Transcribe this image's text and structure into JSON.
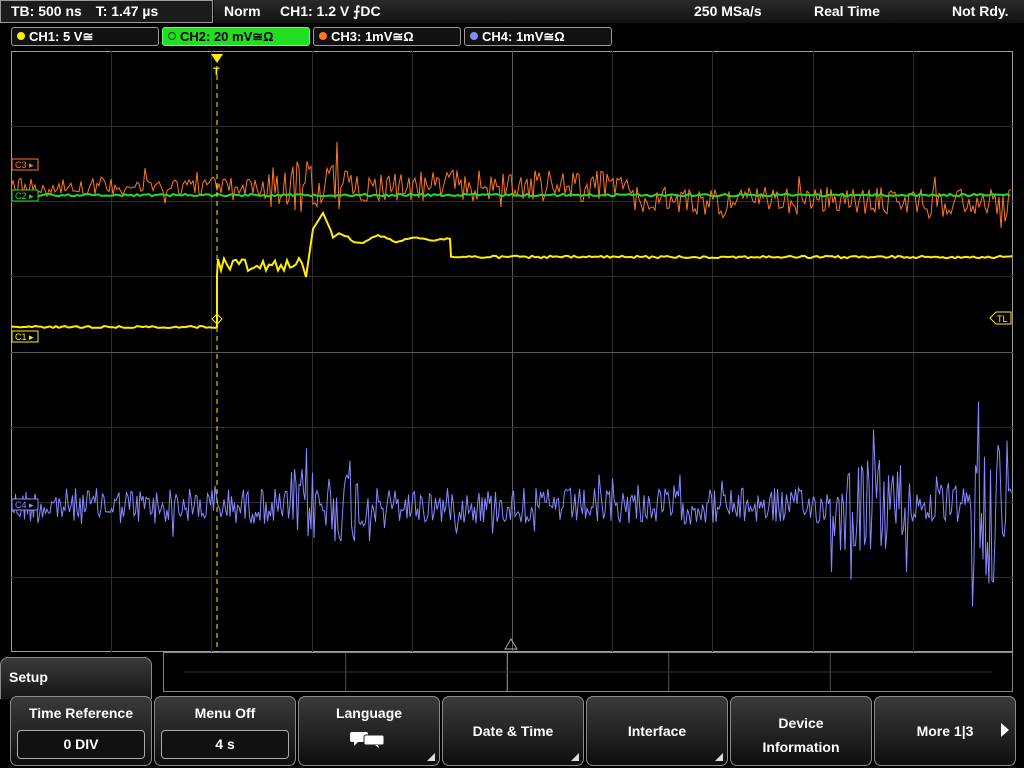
{
  "header": {
    "timebase": "TB: 500 ns",
    "trigger_time": "T: 1.47 µs",
    "acq_mode": "Norm",
    "trigger_setting": "CH1: 1.2 V ⨍DC",
    "sample_rate": "250 MSa/s",
    "mode": "Real Time",
    "status": "Not Rdy."
  },
  "channels": [
    {
      "label": "CH1: 5 V≅",
      "color": "#ffee00"
    },
    {
      "label": "CH2: 20 mV≅Ω",
      "color": "#22dd22"
    },
    {
      "label": "CH3: 1mV≅Ω",
      "color": "#ff7722"
    },
    {
      "label": "CH4: 1mV≅Ω",
      "color": "#8888ff"
    }
  ],
  "markers": {
    "ch3": "C3 ▸",
    "ch2": "C2 ▸",
    "ch1": "C1 ▸",
    "ch4": "C4 ▸",
    "trigger_level": "TL",
    "trigger_top": "T"
  },
  "menu": {
    "title": "Setup",
    "softkeys": {
      "time_reference": {
        "title": "Time Reference",
        "value": "0 DIV"
      },
      "menu_off": {
        "title": "Menu Off",
        "value": "4 s"
      },
      "language": {
        "title": "Language",
        "icon": "speech-bubble-icon"
      },
      "date_time": {
        "title": "Date & Time"
      },
      "interface": {
        "title": "Interface"
      },
      "device_info": {
        "line1": "Device",
        "line2": "Information"
      },
      "more": {
        "title": "More 1|3"
      }
    }
  }
}
